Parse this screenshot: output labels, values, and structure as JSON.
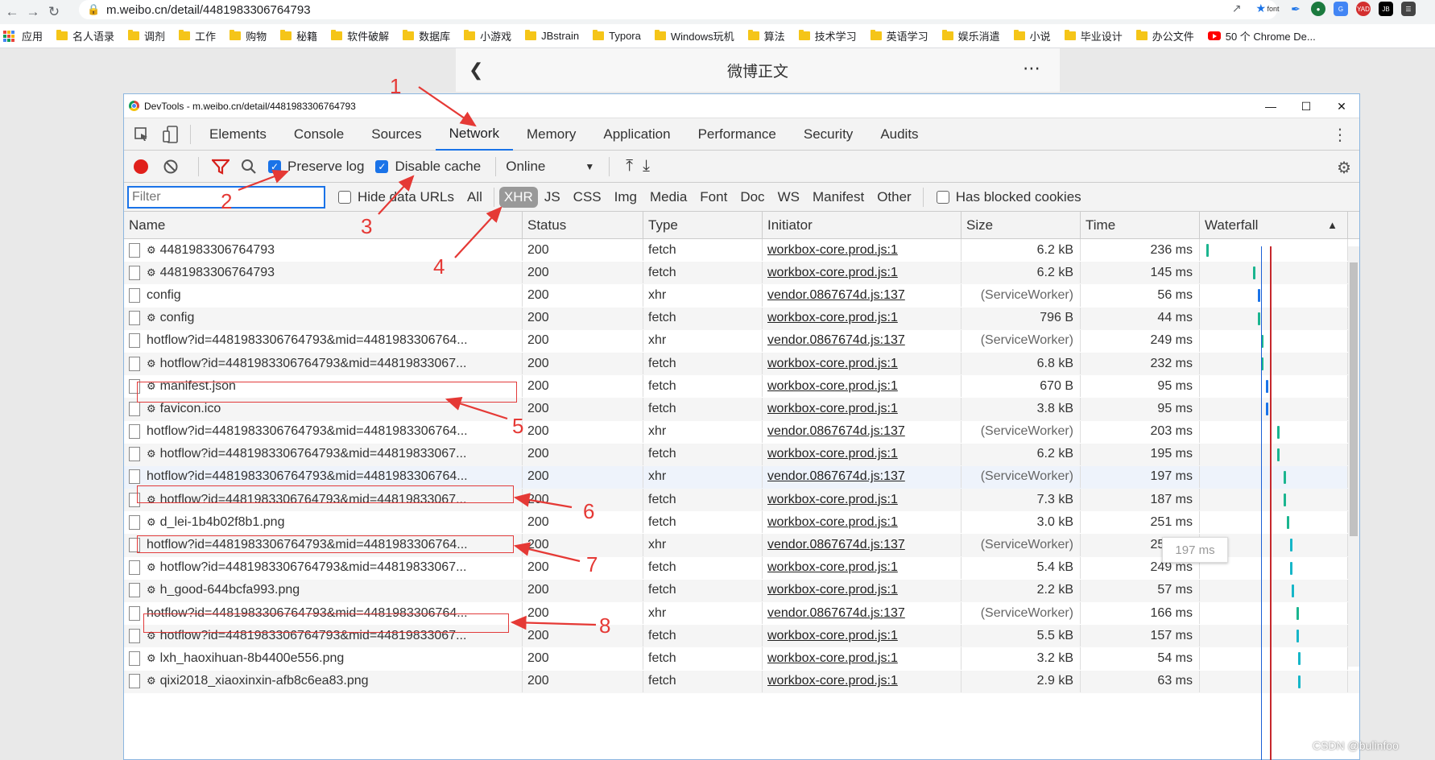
{
  "browser": {
    "url": "m.weibo.cn/detail/4481983306764793",
    "ext_font_label": "font",
    "bookmarks": [
      "应用",
      "名人语录",
      "调剂",
      "工作",
      "购物",
      "秘籍",
      "软件破解",
      "数据库",
      "小游戏",
      "JBstrain",
      "Typora",
      "Windows玩机",
      "算法",
      "技术学习",
      "英语学习",
      "娱乐消遣",
      "小说",
      "毕业设计",
      "办公文件",
      "50 个 Chrome De..."
    ]
  },
  "page": {
    "title": "微博正文"
  },
  "devtools": {
    "window_title": "DevTools - m.weibo.cn/detail/4481983306764793",
    "tabs": [
      "Elements",
      "Console",
      "Sources",
      "Network",
      "Memory",
      "Application",
      "Performance",
      "Security",
      "Audits"
    ],
    "active_tab": "Network",
    "toolbar": {
      "preserve_log": "Preserve log",
      "disable_cache": "Disable cache",
      "throttle": "Online"
    },
    "filter": {
      "placeholder": "Filter",
      "hide_data_urls": "Hide data URLs",
      "types": [
        "All",
        "XHR",
        "JS",
        "CSS",
        "Img",
        "Media",
        "Font",
        "Doc",
        "WS",
        "Manifest",
        "Other"
      ],
      "active_type": "XHR",
      "blocked_cookies": "Has blocked cookies"
    },
    "columns": [
      "Name",
      "Status",
      "Type",
      "Initiator",
      "Size",
      "Time",
      "Waterfall"
    ],
    "rows": [
      {
        "name": "4481983306764793",
        "gear": true,
        "status": "200",
        "type": "fetch",
        "initiator": "workbox-core.prod.js:1",
        "size": "6.2 kB",
        "time": "236 ms"
      },
      {
        "name": "4481983306764793",
        "gear": true,
        "status": "200",
        "type": "fetch",
        "initiator": "workbox-core.prod.js:1",
        "size": "6.2 kB",
        "time": "145 ms"
      },
      {
        "name": "config",
        "gear": false,
        "status": "200",
        "type": "xhr",
        "initiator": "vendor.0867674d.js:137",
        "size": "(ServiceWorker)",
        "time": "56 ms"
      },
      {
        "name": "config",
        "gear": true,
        "status": "200",
        "type": "fetch",
        "initiator": "workbox-core.prod.js:1",
        "size": "796 B",
        "time": "44 ms"
      },
      {
        "name": "hotflow?id=4481983306764793&mid=4481983306764...",
        "gear": false,
        "status": "200",
        "type": "xhr",
        "initiator": "vendor.0867674d.js:137",
        "size": "(ServiceWorker)",
        "time": "249 ms"
      },
      {
        "name": "hotflow?id=4481983306764793&mid=44819833067...",
        "gear": true,
        "status": "200",
        "type": "fetch",
        "initiator": "workbox-core.prod.js:1",
        "size": "6.8 kB",
        "time": "232 ms"
      },
      {
        "name": "manifest.json",
        "gear": true,
        "status": "200",
        "type": "fetch",
        "initiator": "workbox-core.prod.js:1",
        "size": "670 B",
        "time": "95 ms"
      },
      {
        "name": "favicon.ico",
        "gear": true,
        "status": "200",
        "type": "fetch",
        "initiator": "workbox-core.prod.js:1",
        "size": "3.8 kB",
        "time": "95 ms"
      },
      {
        "name": "hotflow?id=4481983306764793&mid=4481983306764...",
        "gear": false,
        "status": "200",
        "type": "xhr",
        "initiator": "vendor.0867674d.js:137",
        "size": "(ServiceWorker)",
        "time": "203 ms"
      },
      {
        "name": "hotflow?id=4481983306764793&mid=44819833067...",
        "gear": true,
        "status": "200",
        "type": "fetch",
        "initiator": "workbox-core.prod.js:1",
        "size": "6.2 kB",
        "time": "195 ms"
      },
      {
        "name": "hotflow?id=4481983306764793&mid=4481983306764...",
        "gear": false,
        "status": "200",
        "type": "xhr",
        "initiator": "vendor.0867674d.js:137",
        "size": "(ServiceWorker)",
        "time": "197 ms"
      },
      {
        "name": "hotflow?id=4481983306764793&mid=44819833067...",
        "gear": true,
        "status": "200",
        "type": "fetch",
        "initiator": "workbox-core.prod.js:1",
        "size": "7.3 kB",
        "time": "187 ms"
      },
      {
        "name": "d_lei-1b4b02f8b1.png",
        "gear": true,
        "status": "200",
        "type": "fetch",
        "initiator": "workbox-core.prod.js:1",
        "size": "3.0 kB",
        "time": "251 ms"
      },
      {
        "name": "hotflow?id=4481983306764793&mid=4481983306764...",
        "gear": false,
        "status": "200",
        "type": "xhr",
        "initiator": "vendor.0867674d.js:137",
        "size": "(ServiceWorker)",
        "time": "259 ms"
      },
      {
        "name": "hotflow?id=4481983306764793&mid=44819833067...",
        "gear": true,
        "status": "200",
        "type": "fetch",
        "initiator": "workbox-core.prod.js:1",
        "size": "5.4 kB",
        "time": "249 ms"
      },
      {
        "name": "h_good-644bcfa993.png",
        "gear": true,
        "status": "200",
        "type": "fetch",
        "initiator": "workbox-core.prod.js:1",
        "size": "2.2 kB",
        "time": "57 ms"
      },
      {
        "name": "hotflow?id=4481983306764793&mid=4481983306764...",
        "gear": false,
        "status": "200",
        "type": "xhr",
        "initiator": "vendor.0867674d.js:137",
        "size": "(ServiceWorker)",
        "time": "166 ms"
      },
      {
        "name": "hotflow?id=4481983306764793&mid=44819833067...",
        "gear": true,
        "status": "200",
        "type": "fetch",
        "initiator": "workbox-core.prod.js:1",
        "size": "5.5 kB",
        "time": "157 ms"
      },
      {
        "name": "lxh_haoxihuan-8b4400e556.png",
        "gear": true,
        "status": "200",
        "type": "fetch",
        "initiator": "workbox-core.prod.js:1",
        "size": "3.2 kB",
        "time": "54 ms"
      },
      {
        "name": "qixi2018_xiaoxinxin-afb8c6ea83.png",
        "gear": true,
        "status": "200",
        "type": "fetch",
        "initiator": "workbox-core.prod.js:1",
        "size": "2.9 kB",
        "time": "63 ms"
      }
    ],
    "tooltip": "197 ms"
  },
  "annotations": [
    "1",
    "2",
    "3",
    "4",
    "5",
    "6",
    "7",
    "8"
  ],
  "watermark": "CSDN @bulinfoo"
}
